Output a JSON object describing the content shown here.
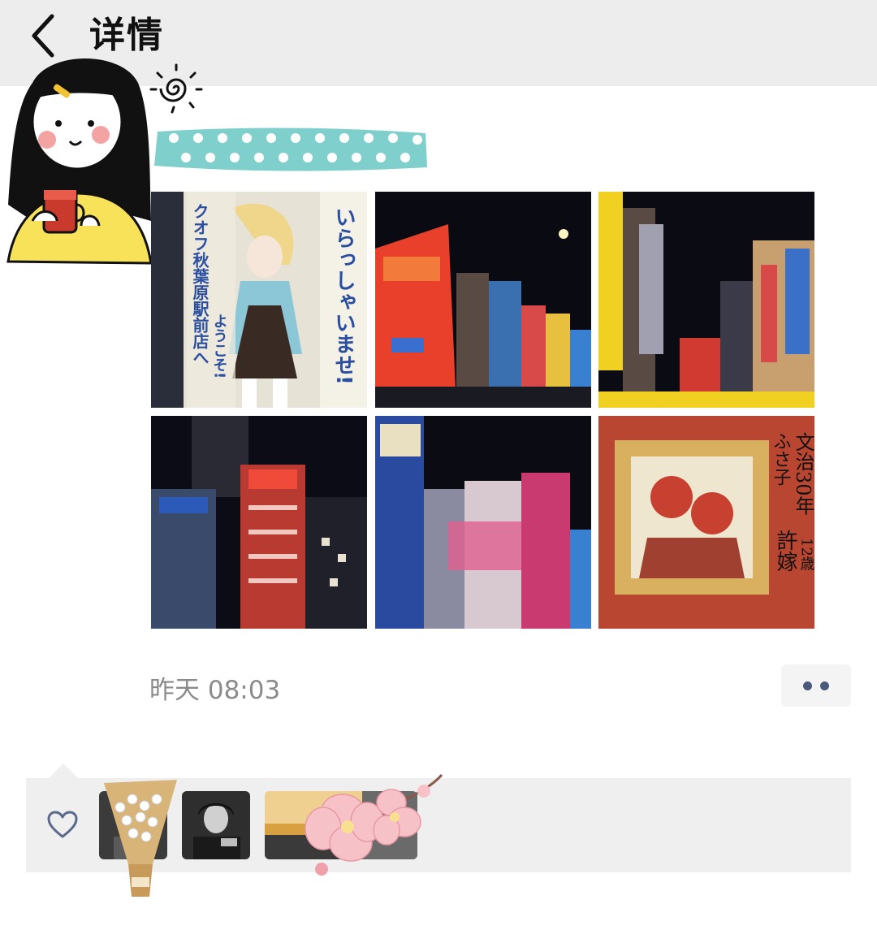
{
  "header": {
    "title": "详情",
    "back_icon": "chevron-left-icon"
  },
  "post": {
    "photos": [
      {
        "name": "photo-anime-banner",
        "colors": [
          "#d8d4c8",
          "#2a2e3a",
          "#2b5fb0"
        ],
        "text": "いらっしゃいませ! クオフ秋葉原駅前店へようこそ!"
      },
      {
        "name": "photo-akihabara-street-1",
        "colors": [
          "#0a0a12",
          "#e8402a",
          "#3a6fd0"
        ]
      },
      {
        "name": "photo-akihabara-street-2",
        "colors": [
          "#0b0b14",
          "#f0d020",
          "#d03a30"
        ]
      },
      {
        "name": "photo-akihabara-street-3",
        "colors": [
          "#0c0c16",
          "#e03a30",
          "#2b5ab8"
        ]
      },
      {
        "name": "photo-akihabara-street-4",
        "colors": [
          "#0b0b14",
          "#c83a70",
          "#3a80d0"
        ]
      },
      {
        "name": "photo-framed-painting",
        "colors": [
          "#b84630",
          "#d8b060",
          "#efe6d0"
        ],
        "text": "文治30年 ふさ子 許嫁 12歳"
      }
    ],
    "timestamp": "昨天 08:03",
    "more_icon": "more-dots-icon"
  },
  "likes": {
    "heart_icon": "heart-outline-icon",
    "avatars": [
      {
        "name": "avatar-like-1",
        "color": "#3b3b3b"
      },
      {
        "name": "avatar-like-2",
        "color": "#2e2e2e"
      },
      {
        "name": "avatar-like-3",
        "color": "#d8a040"
      }
    ]
  },
  "decor": {
    "girl_icon": "girl-with-cup-sticker-icon",
    "sun_icon": "sun-doodle-icon",
    "tape_icon": "polka-dot-tape-icon",
    "flower_icon": "cherry-blossom-sticker-icon",
    "bouquet_icon": "flower-bouquet-sticker-icon"
  },
  "colors": {
    "topbar_bg": "#ededed",
    "timestamp": "#8b8b8b",
    "more_dots": "#4a5a7c",
    "likes_bg": "#efefef",
    "heart": "#5a6a8c",
    "tape": "#7fd0cc"
  }
}
